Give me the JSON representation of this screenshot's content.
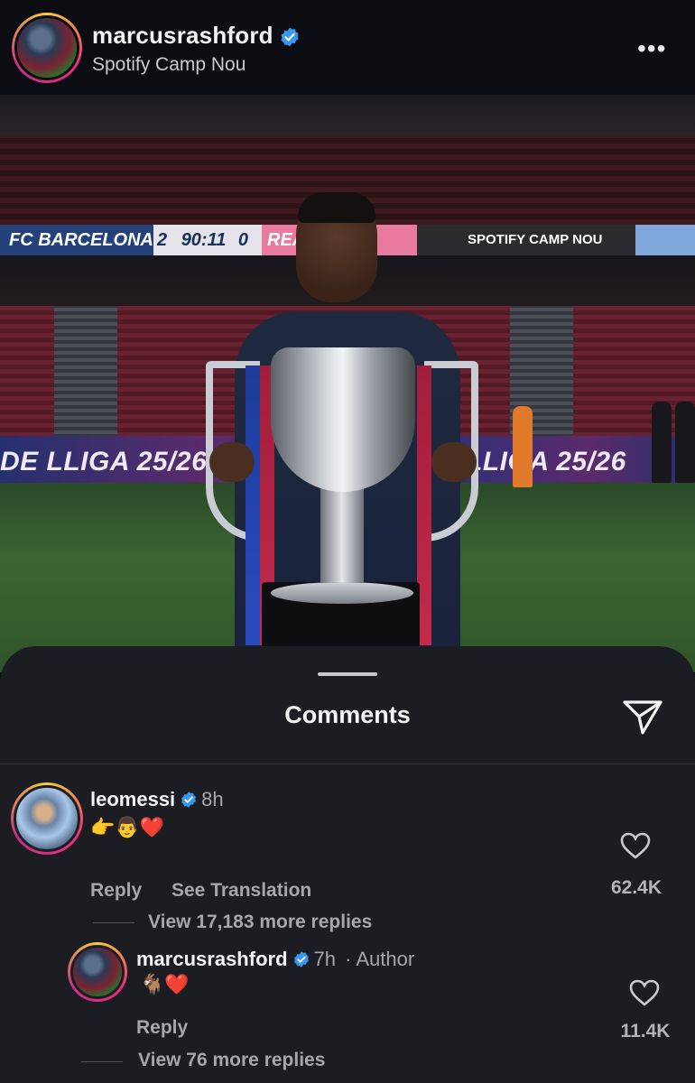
{
  "post": {
    "username": "marcusrashford",
    "location": "Spotify Camp Nou",
    "more_icon": "more-horizontal-icon"
  },
  "photo": {
    "scoreboard": {
      "home": "FC BARCELONA",
      "score_home": "2",
      "clock": "90:11",
      "score_away": "0",
      "away": "REAL",
      "sponsor": "SPOTIFY CAMP NOU"
    },
    "boards_left": "DE LLIGA 25/26",
    "boards_right": "LLIGA 25/26"
  },
  "comments_sheet": {
    "title": "Comments",
    "share_icon": "send-icon",
    "comments": [
      {
        "username": "leomessi",
        "time": "8h",
        "text": "👉👨❤️",
        "reply_label": "Reply",
        "translation_label": "See Translation",
        "likes": "62.4K",
        "view_replies": "View 17,183 more replies"
      }
    ],
    "reply": {
      "username": "marcusrashford",
      "time": "7h",
      "author_label": "· Author",
      "text": "🐐❤️",
      "reply_label": "Reply",
      "likes": "11.4K",
      "view_replies": "View 76 more replies"
    }
  },
  "colors": {
    "background": "#0c0d12",
    "sheet": "#1c1d22",
    "verified": "#3897f0",
    "muted": "#a6a7ad"
  }
}
